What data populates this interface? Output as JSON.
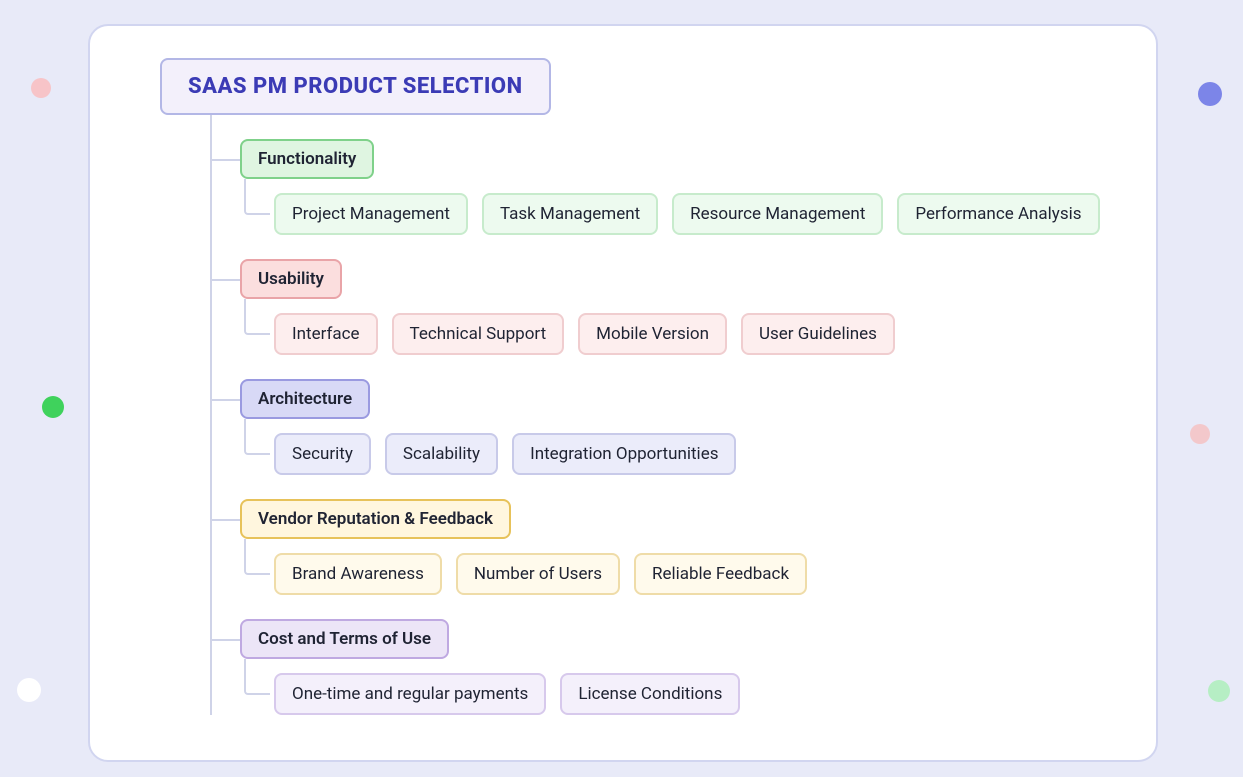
{
  "root": {
    "title": "SAAS PM PRODUCT SELECTION"
  },
  "sections": [
    {
      "key": "functionality",
      "label": "Functionality",
      "color": "green",
      "children": [
        "Project Management",
        "Task Management",
        "Resource Management",
        "Performance Analysis"
      ]
    },
    {
      "key": "usability",
      "label": "Usability",
      "color": "red",
      "children": [
        "Interface",
        "Technical Support",
        "Mobile Version",
        "User Guidelines"
      ]
    },
    {
      "key": "architecture",
      "label": "Architecture",
      "color": "blue",
      "children": [
        "Security",
        "Scalability",
        "Integration Opportunities"
      ]
    },
    {
      "key": "vendor",
      "label": "Vendor Reputation & Feedback",
      "color": "yellow",
      "children": [
        "Brand Awareness",
        "Number of Users",
        "Reliable Feedback"
      ]
    },
    {
      "key": "cost",
      "label": "Cost and Terms of Use",
      "color": "purple",
      "children": [
        "One-time and regular payments",
        "License Conditions"
      ]
    }
  ]
}
